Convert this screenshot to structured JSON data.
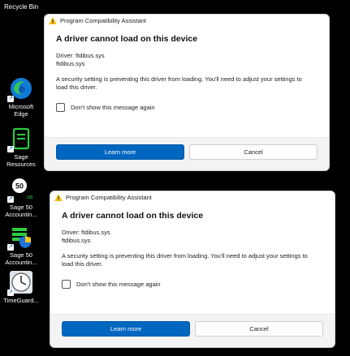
{
  "desktop": {
    "recycle_bin": "Recycle Bin",
    "icons": [
      {
        "label1": "Microsoft",
        "label2": "Edge"
      },
      {
        "label1": "Sage",
        "label2": "Resources"
      },
      {
        "label1": "Sage 50",
        "label2": "Accountin..."
      },
      {
        "label1": "Sage 50",
        "label2": "Accountin..."
      },
      {
        "label1": "TimeGuard...",
        "label2": ""
      }
    ],
    "sage50_badge": "50"
  },
  "dialogs": [
    {
      "title": "Program Compatibility Assistant",
      "heading": "A driver cannot load on this device",
      "driver_line": "Driver: ftdibus.sys",
      "file_line": "ftdibus.sys",
      "message": "A security setting is preventing this driver from loading. You'll need to adjust your settings to load this driver.",
      "checkbox_label": "Don't show this message again",
      "learn_more": "Learn more",
      "cancel": "Cancel"
    },
    {
      "title": "Program Compatibility Assistant",
      "heading": "A driver cannot load on this device",
      "driver_line": "Driver: ftdibus.sys",
      "file_line": "ftdibus.sys",
      "message": "A security setting is preventing this driver from loading. You'll need to adjust your settings to load this driver.",
      "checkbox_label": "Don't show this message again",
      "learn_more": "Learn more",
      "cancel": "Cancel"
    }
  ],
  "colors": {
    "accent": "#0067c0",
    "warning": "#f5c518",
    "desktop": "#000000"
  }
}
